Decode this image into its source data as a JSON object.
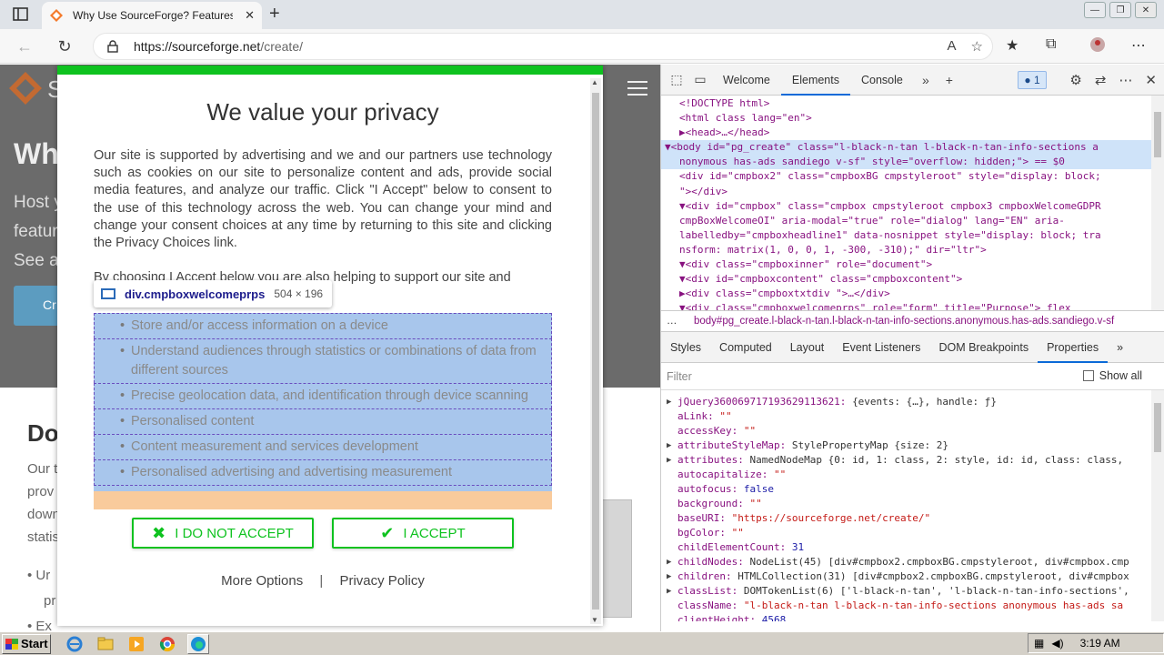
{
  "browser": {
    "tab_title": "Why Use SourceForge? Features &",
    "tab_close": "✕",
    "new_tab": "+",
    "url_host": "https://sourceforge.net",
    "url_path": "/create/",
    "window_buttons": [
      "—",
      "❐",
      "✕"
    ]
  },
  "site": {
    "logo_text": "S",
    "hero": "Wh",
    "subtitle_lines": [
      "Host y",
      "featur",
      "See a"
    ],
    "cta": "Cr",
    "section_title": "Do",
    "body_lines": [
      "Our t",
      "prov",
      "down",
      "statis"
    ],
    "bullets": [
      "• Ur",
      "  pr",
      "• Ex"
    ]
  },
  "consent": {
    "title": "We value your privacy",
    "intro": "Our site is supported by advertising and we and our partners use technology such as cookies on our site to personalize content and ads, provide social media features, and analyze our traffic. Click \"I Accept\" below to consent to the use of this technology across the web. You can change your mind and change your consent choices at any time by returning to this site and clicking the Privacy Choices link.",
    "choosing": "By choosing I Accept below you are also helping to support our site and",
    "purposes": [
      "Store and/or access information on a device",
      "Understand audiences through statistics or combinations of data from different sources",
      "Precise geolocation data, and identification through device scanning",
      "Personalised content",
      "Content measurement and services development",
      "Personalised advertising and advertising measurement"
    ],
    "decline_label": "I DO NOT ACCEPT",
    "accept_label": "I ACCEPT",
    "more_options": "More Options",
    "separator": "|",
    "privacy_policy": "Privacy Policy"
  },
  "inspect_tooltip": {
    "selector": "div.cmpboxwelcomeprps",
    "dims": "504 × 196"
  },
  "devtools": {
    "tabs": [
      "Welcome",
      "Elements",
      "Console"
    ],
    "active_tab": "Elements",
    "issues_count": "1",
    "breadcrumb": "body#pg_create.l-black-n-tan.l-black-n-tan-info-sections.anonymous.has-ads.sandiego.v-sf",
    "sub_tabs": [
      "Styles",
      "Computed",
      "Layout",
      "Event Listeners",
      "DOM Breakpoints",
      "Properties"
    ],
    "active_sub_tab": "Properties",
    "filter_placeholder": "Filter",
    "show_all": "Show all",
    "dom_lines": [
      "<!DOCTYPE html>",
      "<html class lang=\"en\">",
      "▶<head>…</head>",
      "▼<body id=\"pg_create\" class=\"l-black-n-tan l-black-n-tan-info-sections  a",
      "nonymous has-ads sandiego v-sf\" style=\"overflow: hidden;\"> == $0",
      "  <div id=\"cmpbox2\" class=\"cmpboxBG cmpstyleroot\" style=\"display: block;",
      "  \"></div>",
      " ▼<div id=\"cmpbox\" class=\"cmpbox cmpstyleroot cmpbox3 cmpboxWelcomeGDPR",
      "  cmpBoxWelcomeOI\" aria-modal=\"true\" role=\"dialog\" lang=\"EN\" aria-",
      "  labelledby=\"cmpboxheadline1\" data-nosnippet style=\"display: block; tra",
      "  nsform: matrix(1, 0, 0, 1, -300, -310);\" dir=\"ltr\">",
      "   ▼<div class=\"cmpboxinner\" role=\"document\">",
      "     ▼<div id=\"cmpboxcontent\" class=\"cmpboxcontent\">",
      "       ▶<div class=\"cmpboxtxtdiv \">…</div>",
      "       ▼<div class=\"cmpboxwelcomeprps\" role=\"form\" title=\"Purpose\"> flex"
    ],
    "properties": [
      {
        "expand": true,
        "key": "jQuery3600697171936291136​21",
        "val": "{events: {…}, handle: ƒ}"
      },
      {
        "expand": false,
        "key": "aLink",
        "val": "\"\""
      },
      {
        "expand": false,
        "key": "accessKey",
        "val": "\"\""
      },
      {
        "expand": true,
        "key": "attributeStyleMap",
        "val": "StylePropertyMap {size: 2}"
      },
      {
        "expand": true,
        "key": "attributes",
        "val": "NamedNodeMap {0: id, 1: class, 2: style, id: id, class: class,"
      },
      {
        "expand": false,
        "key": "autocapitalize",
        "val": "\"\""
      },
      {
        "expand": false,
        "key": "autofocus",
        "val": "false"
      },
      {
        "expand": false,
        "key": "background",
        "val": "\"\""
      },
      {
        "expand": false,
        "key": "baseURI",
        "val": "\"https://sourceforge.net/create/\""
      },
      {
        "expand": false,
        "key": "bgColor",
        "val": "\"\""
      },
      {
        "expand": false,
        "key": "childElementCount",
        "val": "31"
      },
      {
        "expand": true,
        "key": "childNodes",
        "val": "NodeList(45) [div#cmpbox2.cmpboxBG.cmpstyleroot, div#cmpbox.cmp"
      },
      {
        "expand": true,
        "key": "children",
        "val": "HTMLCollection(31) [div#cmpbox2.cmpboxBG.cmpstyleroot, div#cmpbox"
      },
      {
        "expand": true,
        "key": "classList",
        "val": "DOMTokenList(6) ['l-black-n-tan', 'l-black-n-tan-info-sections',"
      },
      {
        "expand": false,
        "key": "className",
        "val": "\"l-black-n-tan l-black-n-tan-info-sections anonymous has-ads sa"
      },
      {
        "expand": false,
        "key": "clientHeight",
        "val": "4568"
      }
    ]
  },
  "taskbar": {
    "start": "Start",
    "clock": "3:19 AM"
  },
  "colors": {
    "consent_accent": "#0ec21f",
    "highlight": "#a8c6ec",
    "padding_overlay": "#f9cb9c"
  }
}
